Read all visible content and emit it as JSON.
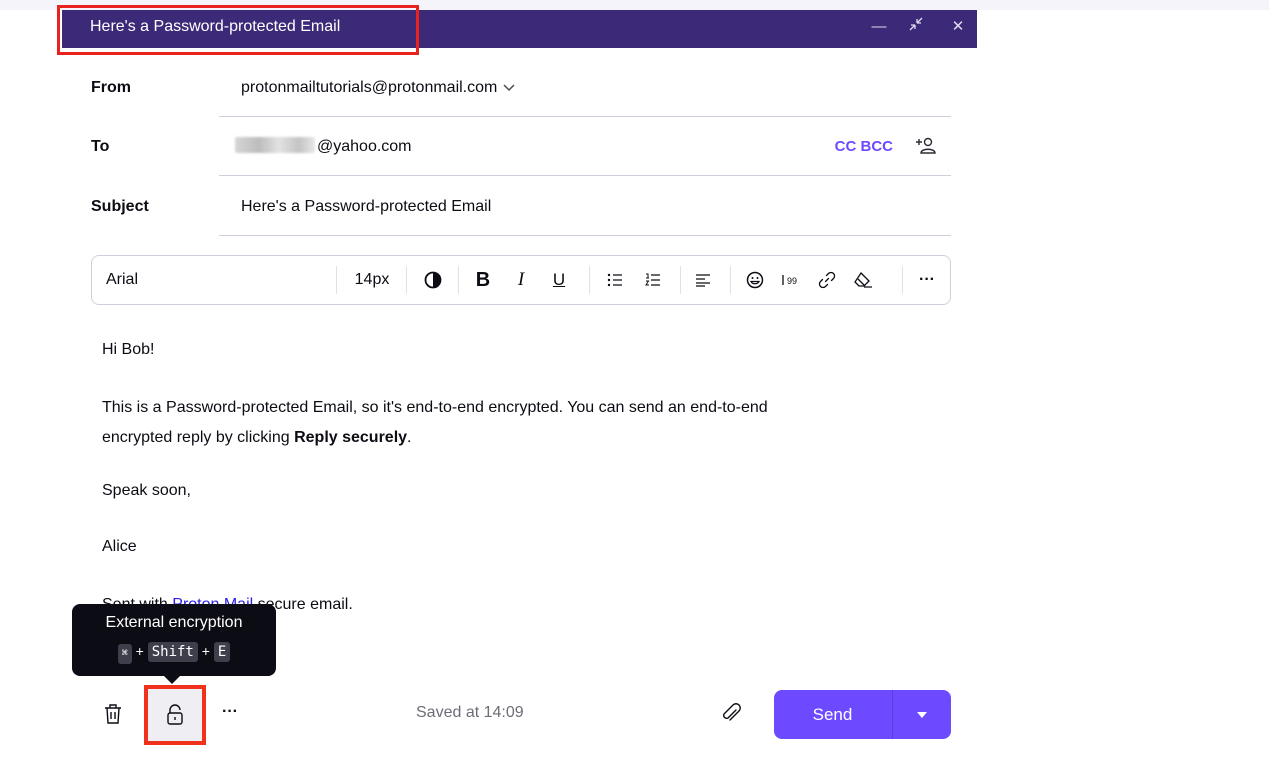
{
  "window": {
    "title": "Here's a Password-protected Email",
    "minimize_glyph": "—",
    "collapse_glyph": "⤡",
    "close_glyph": "✕"
  },
  "header": {
    "from_label": "From",
    "from_value": "protonmailtutorials@protonmail.com",
    "to_label": "To",
    "to_value": "@yahoo.com",
    "cc_bcc_label": "CC BCC",
    "subject_label": "Subject",
    "subject_value": "Here's a Password-protected Email"
  },
  "toolbar": {
    "font_family": "Arial",
    "font_size": "14px",
    "bold": "B",
    "italic": "I",
    "underline": "U",
    "more": "···"
  },
  "body": {
    "greeting": "Hi Bob!",
    "para_line1": "This is a Password-protected Email, so it's end-to-end encrypted. You can send an end-to-end",
    "para_line2_prefix": "encrypted reply by clicking ",
    "para_line2_bold": "Reply securely",
    "para_line2_suffix": ".",
    "closing": "Speak soon,",
    "signature_name": "Alice",
    "sent_prefix": "Sent with ",
    "sent_link": "Proton Mail",
    "sent_suffix": " secure email."
  },
  "tooltip": {
    "title": "External encryption",
    "key_cmd": "⌘",
    "plus": "+",
    "key_shift": "Shift",
    "key_e": "E"
  },
  "footer": {
    "more": "···",
    "saved_status": "Saved at 14:09",
    "send_label": "Send"
  },
  "colors": {
    "titlebar": "#3c2a78",
    "accent": "#6d4aff",
    "highlight": "#e8231f"
  }
}
